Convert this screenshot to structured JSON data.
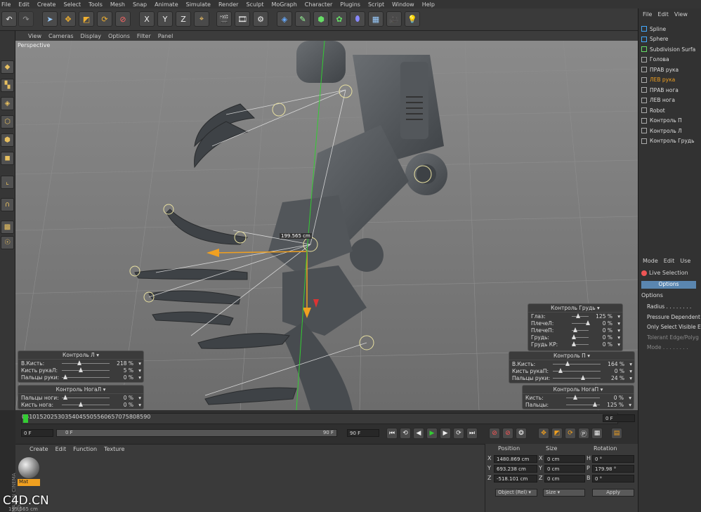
{
  "menu": [
    "File",
    "Edit",
    "Create",
    "Select",
    "Tools",
    "Mesh",
    "Snap",
    "Animate",
    "Simulate",
    "Render",
    "Sculpt",
    "MoGraph",
    "Character",
    "Plugins",
    "Script",
    "Window",
    "Help"
  ],
  "toolbar": {
    "axis_x": "X",
    "axis_y": "Y",
    "axis_z": "Z"
  },
  "viewport": {
    "menu": [
      "View",
      "Cameras",
      "Display",
      "Options",
      "Filter",
      "Panel"
    ],
    "label": "Perspective",
    "measure": "199.565 cm"
  },
  "controls": {
    "grud": {
      "title": "Контроль Грудь",
      "rows": [
        {
          "label": "Глаз:",
          "value": "125 %"
        },
        {
          "label": "ПлечеЛ:",
          "value": "0 %"
        },
        {
          "label": "ПлечеП:",
          "value": "0 %"
        },
        {
          "label": "Грудь:",
          "value": "0 %"
        },
        {
          "label": "Грудь КР:",
          "value": "0 %"
        }
      ]
    },
    "ctrl_l": {
      "title": "Контроль Л",
      "rows": [
        {
          "label": "В.Кисть:",
          "value": "218 %"
        },
        {
          "label": "Кисть рукаЛ:",
          "value": "5 %"
        },
        {
          "label": "Пальцы руки:",
          "value": "0 %"
        }
      ]
    },
    "ctrl_p": {
      "title": "Контроль П",
      "rows": [
        {
          "label": "В.Кисть:",
          "value": "164 %"
        },
        {
          "label": "Кисть рукаП:",
          "value": "0 %"
        },
        {
          "label": "Пальцы руки:",
          "value": "24 %"
        }
      ]
    },
    "noga_l": {
      "title": "Контроль НогаЛ",
      "rows": [
        {
          "label": "Пальцы ноги:",
          "value": "0 %"
        },
        {
          "label": "Кисть нога:",
          "value": "0 %"
        }
      ]
    },
    "noga_p": {
      "title": "Контроль НогаП",
      "rows": [
        {
          "label": "Кисть:",
          "value": "0 %"
        },
        {
          "label": "Пальцы:",
          "value": "125 %"
        }
      ]
    }
  },
  "timeline": {
    "ticks": [
      "0",
      "5",
      "10",
      "15",
      "20",
      "25",
      "30",
      "35",
      "40",
      "45",
      "50",
      "55",
      "60",
      "65",
      "70",
      "75",
      "80",
      "85",
      "90"
    ],
    "frame_field": "0 F",
    "start": "0 F",
    "cur": "0 F",
    "end": "90 F",
    "end2": "90 F"
  },
  "material": {
    "menu": [
      "Create",
      "Edit",
      "Function",
      "Texture"
    ],
    "name": "Mat"
  },
  "coords": {
    "headers": [
      "Position",
      "Size",
      "Rotation"
    ],
    "rows": [
      {
        "axis": "X",
        "pos": "1480.869 cm",
        "size_axis": "X",
        "size": "0 cm",
        "rot_axis": "H",
        "rot": "0 °"
      },
      {
        "axis": "Y",
        "pos": "693.238 cm",
        "size_axis": "Y",
        "size": "0 cm",
        "rot_axis": "P",
        "rot": "179.98 °"
      },
      {
        "axis": "Z",
        "pos": "-518.101 cm",
        "size_axis": "Z",
        "size": "0 cm",
        "rot_axis": "B",
        "rot": "0 °"
      }
    ],
    "mode": "Object (Rel)",
    "size_mode": "Size",
    "apply": "Apply"
  },
  "objects": {
    "menu": [
      "File",
      "Edit",
      "View"
    ],
    "items": [
      "Spline",
      "Sphere",
      "Subdivision Surfa",
      "Голова",
      "ПРАВ рука",
      "ЛЕВ рука",
      "ПРАВ нога",
      "ЛЕВ нога",
      "Robot",
      "Контроль П",
      "Контроль Л",
      "Контроль Грудь"
    ]
  },
  "attributes": {
    "menu": [
      "Mode",
      "Edit",
      "Use"
    ],
    "title": "Live Selection",
    "tab": "Options",
    "section": "Options",
    "options": [
      "Radius . . . . . . . .",
      "Pressure Dependent",
      "Only Select Visible El",
      "Tolerant Edge/Polyg",
      "Mode . . . . . . . ."
    ]
  },
  "watermark": "C4D.CN",
  "brand": "MAXON CINEMA 4D",
  "status": "199.565 cm",
  "colors": {
    "accent": "#f0a020",
    "viewport": "#7a7a7a",
    "panel": "#3a3a3a"
  }
}
